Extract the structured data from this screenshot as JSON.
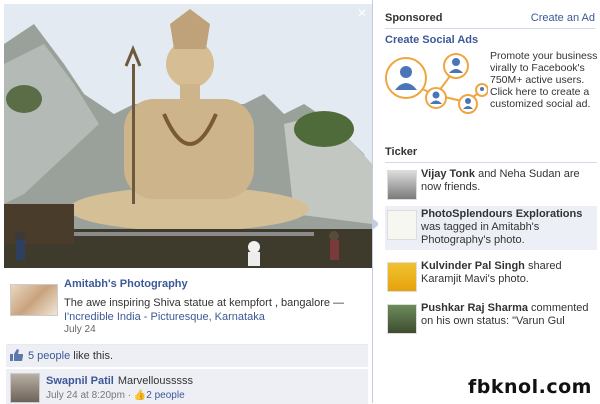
{
  "photo": {
    "owner_name": "Amitabh's Photography",
    "caption_plain": "The awe inspiring Shiva statue at kempfort , bangalore — ",
    "caption_link": "I'ncredible India - Picturesque, Karnataka",
    "date": "July 24",
    "likes_count": "5 people",
    "likes_suffix": " like this."
  },
  "comment": {
    "author": "Swapnil Patil",
    "text": "Marvellousssss",
    "meta_time": "July 24 at 8:20pm · ",
    "meta_likes": "2 people"
  },
  "sidebar": {
    "sponsored_label": "Sponsored",
    "create_ad_label": "Create an Ad",
    "ad": {
      "title": "Create Social Ads",
      "body": "Promote your business virally to Facebook's 750M+ active users. Click here to create a customized social ad."
    },
    "ticker_label": "Ticker",
    "ticker_items": [
      {
        "name": "Vijay Tonk",
        "text": " and Neha Sudan are now friends."
      },
      {
        "name": "PhotoSplendours Explorations",
        "text": " was tagged in Amitabh's Photography's photo."
      },
      {
        "name": "Kulvinder Pal Singh",
        "text": " shared Karamjit Mavi's photo."
      },
      {
        "name": "Pushkar Raj Sharma",
        "text": " commented on his own status: \"Varun Gul"
      }
    ]
  },
  "watermark": "fbknol.com",
  "colors": {
    "link": "#3b5998",
    "bar_bg": "#edeff4",
    "divider": "#d3d9e6"
  }
}
